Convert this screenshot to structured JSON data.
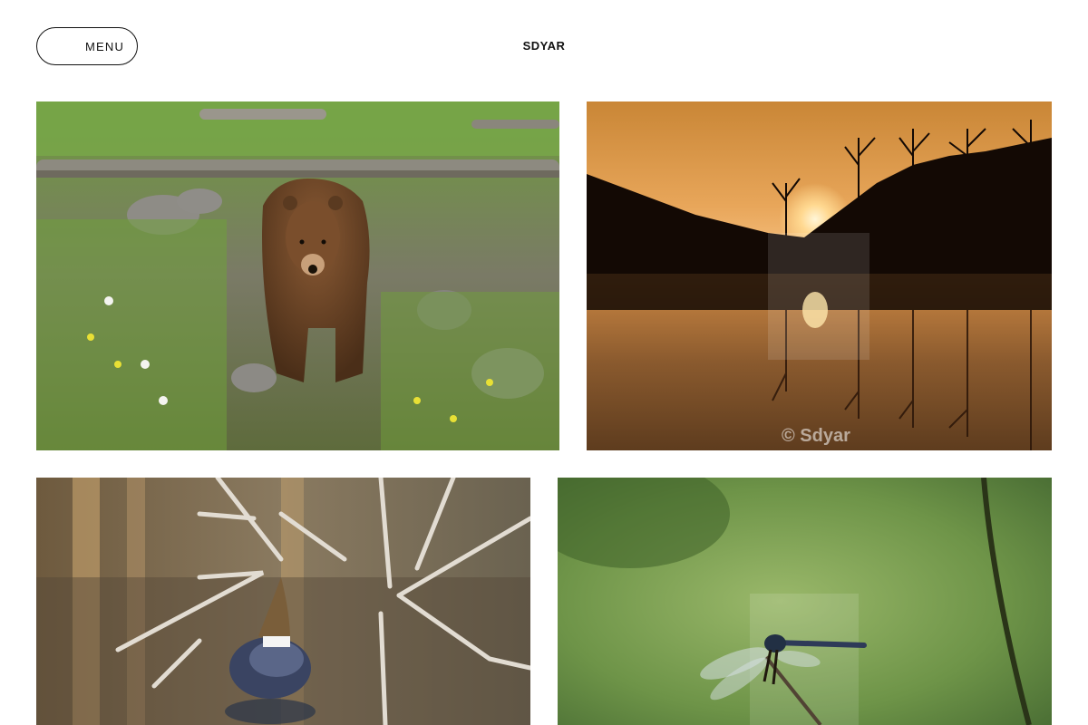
{
  "header": {
    "menu_label": "MENU",
    "site_title": "SDYAR"
  },
  "gallery": {
    "photos": [
      {
        "subject": "Brown bear walking on rocky grassy ground"
      },
      {
        "subject": "Sunset over a lake with silhouetted trees",
        "watermark": "© Sdyar"
      },
      {
        "subject": "Duck standing on branches in a pond"
      },
      {
        "subject": "Dragonfly perched on a twig"
      }
    ]
  },
  "colors": {
    "text": "#111111",
    "background": "#ffffff"
  }
}
